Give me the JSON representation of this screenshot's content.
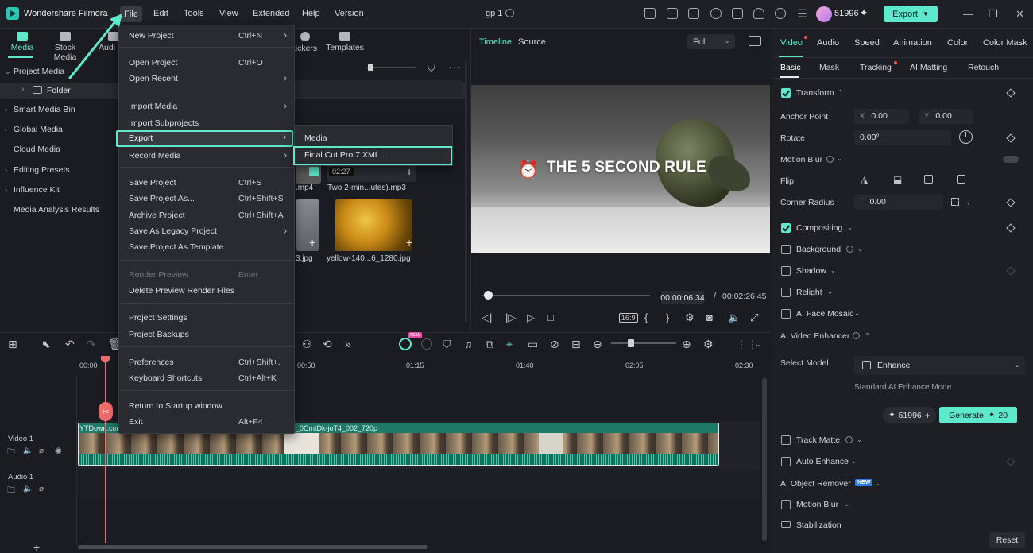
{
  "titlebar": {
    "app_name": "Wondershare Filmora",
    "menus": [
      "File",
      "Edit",
      "Tools",
      "View",
      "Extended",
      "Help",
      "Version"
    ],
    "project_title": "gp 1",
    "credits": "51996",
    "export_label": "Export"
  },
  "media_panel": {
    "tabs": [
      "Media",
      "Stock Media",
      "Audi",
      "tickers",
      "Templates"
    ],
    "tree": [
      "Project Media",
      "Folder",
      "Smart Media Bin",
      "Global Media",
      "Cloud Media",
      "Editing Presets",
      "Influence Kit",
      "Media Analysis Results"
    ],
    "thumbs": [
      {
        "name": ".mp4"
      },
      {
        "name": "Two 2-min...utes).mp3",
        "duration": "02:27"
      },
      {
        "name": "3.jpg"
      },
      {
        "name": "yellow-140...6_1280.jpg"
      }
    ]
  },
  "file_menu": {
    "items": [
      {
        "label": "New Project",
        "shortcut": "Ctrl+N"
      },
      {
        "label": "Open Project",
        "shortcut": "Ctrl+O"
      },
      {
        "label": "Open Recent",
        "shortcut": ""
      },
      {
        "label": "Import Media",
        "shortcut": ""
      },
      {
        "label": "Import Subprojects",
        "shortcut": ""
      },
      {
        "label": "Export",
        "shortcut": ""
      },
      {
        "label": "Record Media",
        "shortcut": ""
      },
      {
        "label": "Save Project",
        "shortcut": "Ctrl+S"
      },
      {
        "label": "Save Project As...",
        "shortcut": "Ctrl+Shift+S"
      },
      {
        "label": "Archive Project",
        "shortcut": "Ctrl+Shift+A"
      },
      {
        "label": "Save As Legacy Project",
        "shortcut": ""
      },
      {
        "label": "Save Project As Template",
        "shortcut": ""
      },
      {
        "label": "Render Preview",
        "shortcut": "Enter"
      },
      {
        "label": "Delete Preview Render Files",
        "shortcut": ""
      },
      {
        "label": "Project Settings",
        "shortcut": ""
      },
      {
        "label": "Project Backups",
        "shortcut": ""
      },
      {
        "label": "Preferences",
        "shortcut": "Ctrl+Shift+,"
      },
      {
        "label": "Keyboard Shortcuts",
        "shortcut": "Ctrl+Alt+K"
      },
      {
        "label": "Return to Startup window",
        "shortcut": ""
      },
      {
        "label": "Exit",
        "shortcut": "Alt+F4"
      }
    ],
    "export_submenu": [
      "Media",
      "Final Cut Pro 7 XML..."
    ]
  },
  "preview": {
    "tabs": [
      "Timeline",
      "Source"
    ],
    "quality": "Full",
    "caption": "THE 5 SECOND RULE",
    "time_current": "00:00:06:34",
    "time_sep": "/",
    "time_total": "00:02:26:45",
    "progress_fraction": 0.04
  },
  "properties": {
    "tabs": [
      "Video",
      "Audio",
      "Speed",
      "Animation",
      "Color",
      "Color Mask"
    ],
    "subtabs": [
      "Basic",
      "Mask",
      "Tracking",
      "AI Matting",
      "Retouch"
    ],
    "transform": "Transform",
    "anchor_point": "Anchor Point",
    "anchor_x_prefix": "X",
    "anchor_x": "0.00",
    "anchor_y_prefix": "Y",
    "anchor_y": "0.00",
    "rotate": "Rotate",
    "rotate_value": "0.00°",
    "motion_blur": "Motion Blur",
    "flip": "Flip",
    "corner_radius": "Corner Radius",
    "corner_radius_value": "0.00",
    "compositing": "Compositing",
    "background": "Background",
    "shadow": "Shadow",
    "relight": "Relight",
    "ai_face_mosaic": "AI Face Mosaic",
    "ai_video_enhancer": "AI Video Enhancer",
    "select_model": "Select Model",
    "model_value": "Enhance",
    "model_desc": "Standard AI Enhance Mode",
    "credit_value": "51996",
    "generate_label": "Generate",
    "generate_cost": "20",
    "track_matte": "Track Matte",
    "auto_enhance": "Auto Enhance",
    "ai_object_remover": "AI Object Remover",
    "new_badge": "NEW",
    "motion_blur2": "Motion Blur",
    "stabilization": "Stabilization",
    "reset_label": "Reset"
  },
  "timeline": {
    "ruler": [
      "00:00",
      "00:50",
      "01:15",
      "01:40",
      "02:05",
      "02:30"
    ],
    "tracks": [
      "Video 1",
      "Audio 1"
    ],
    "clip_name_left": "YTDown.com",
    "clip_name_right": "_0CmtDk-joT4_002_720p",
    "ai_badge": "NEW"
  }
}
